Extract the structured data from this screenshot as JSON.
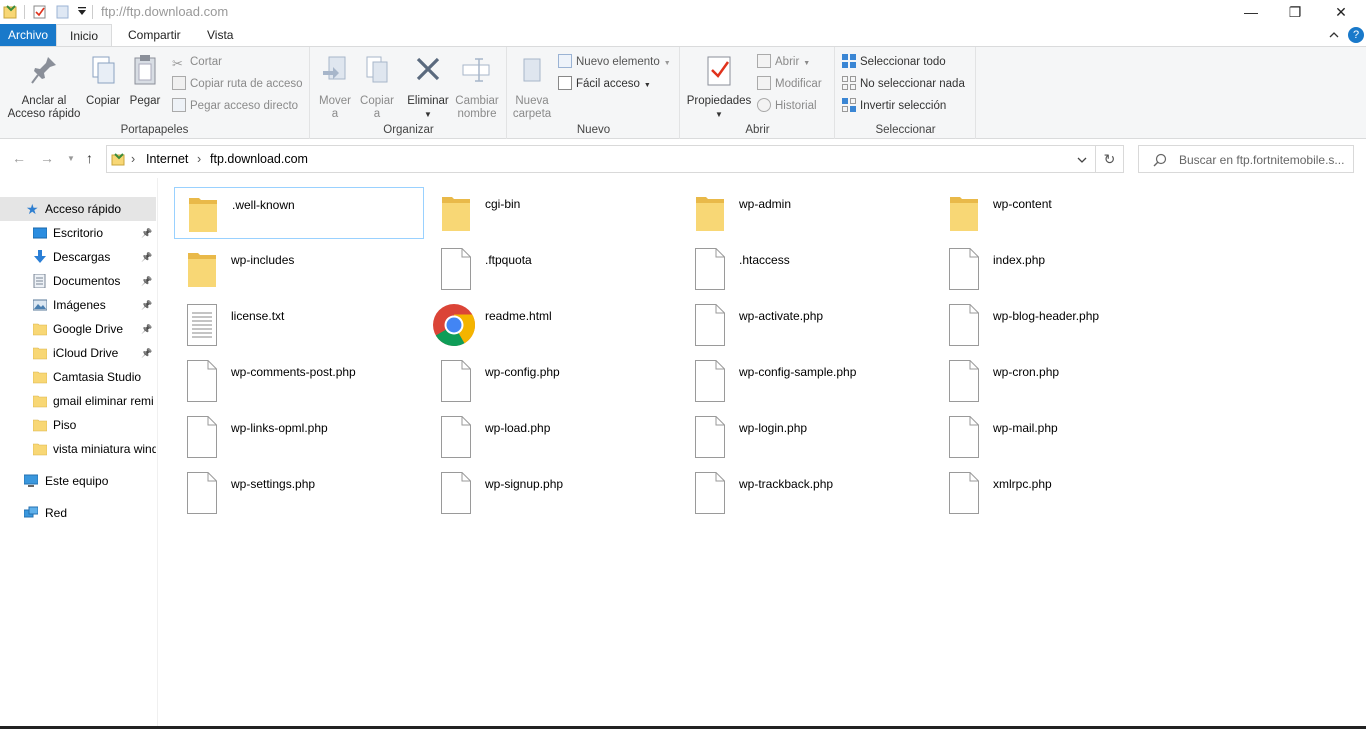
{
  "window": {
    "title": "ftp://ftp.download.com",
    "minimize": "—",
    "maximize": "❐",
    "close": "✕"
  },
  "tabs": {
    "file": "Archivo",
    "home": "Inicio",
    "share": "Compartir",
    "view": "Vista",
    "help": "?"
  },
  "ribbon": {
    "clipboard": {
      "label": "Portapapeles",
      "pin": "Anclar al\nAcceso rápido",
      "pin_l1": "Anclar al",
      "pin_l2": "Acceso rápido",
      "copy": "Copiar",
      "paste": "Pegar",
      "cut": "Cortar",
      "copy_path": "Copiar ruta de acceso",
      "paste_shortcut": "Pegar acceso directo"
    },
    "organize": {
      "label": "Organizar",
      "move_l1": "Mover",
      "move_l2": "a",
      "copy_l1": "Copiar",
      "copy_l2": "a",
      "delete": "Eliminar",
      "rename_l1": "Cambiar",
      "rename_l2": "nombre"
    },
    "new": {
      "label": "Nuevo",
      "new_folder_l1": "Nueva",
      "new_folder_l2": "carpeta",
      "new_item": "Nuevo elemento",
      "easy_access": "Fácil acceso"
    },
    "open": {
      "label": "Abrir",
      "properties": "Propiedades",
      "open": "Abrir",
      "edit": "Modificar",
      "history": "Historial"
    },
    "select": {
      "label": "Seleccionar",
      "select_all": "Seleccionar todo",
      "select_none": "No seleccionar nada",
      "invert": "Invertir selección"
    }
  },
  "address": {
    "crumbs": [
      "Internet",
      "ftp.download.com"
    ],
    "separator": "›",
    "search_placeholder": "Buscar en ftp.fortnitemobile.s..."
  },
  "sidebar": {
    "quick_access": "Acceso rápido",
    "items": [
      {
        "label": "Escritorio",
        "icon": "desktop-icon"
      },
      {
        "label": "Descargas",
        "icon": "downloads-icon"
      },
      {
        "label": "Documentos",
        "icon": "documents-icon"
      },
      {
        "label": "Imágenes",
        "icon": "pictures-icon"
      },
      {
        "label": "Google Drive",
        "icon": "folder-icon"
      },
      {
        "label": "iCloud Drive",
        "icon": "folder-icon"
      },
      {
        "label": "Camtasia Studio",
        "icon": "folder-icon"
      },
      {
        "label": "gmail eliminar remi",
        "icon": "folder-icon"
      },
      {
        "label": "Piso",
        "icon": "folder-icon"
      },
      {
        "label": "vista miniatura wind",
        "icon": "folder-icon"
      }
    ],
    "this_pc": "Este equipo",
    "network": "Red"
  },
  "files": [
    {
      "name": ".well-known",
      "type": "folder"
    },
    {
      "name": "cgi-bin",
      "type": "folder"
    },
    {
      "name": "wp-admin",
      "type": "folder"
    },
    {
      "name": "wp-content",
      "type": "folder"
    },
    {
      "name": "wp-includes",
      "type": "folder"
    },
    {
      "name": ".ftpquota",
      "type": "file"
    },
    {
      "name": ".htaccess",
      "type": "file"
    },
    {
      "name": "index.php",
      "type": "file"
    },
    {
      "name": "license.txt",
      "type": "text"
    },
    {
      "name": "readme.html",
      "type": "chrome"
    },
    {
      "name": "wp-activate.php",
      "type": "file"
    },
    {
      "name": "wp-blog-header.php",
      "type": "file"
    },
    {
      "name": "wp-comments-post.php",
      "type": "file"
    },
    {
      "name": "wp-config.php",
      "type": "file"
    },
    {
      "name": "wp-config-sample.php",
      "type": "file"
    },
    {
      "name": "wp-cron.php",
      "type": "file"
    },
    {
      "name": "wp-links-opml.php",
      "type": "file"
    },
    {
      "name": "wp-load.php",
      "type": "file"
    },
    {
      "name": "wp-login.php",
      "type": "file"
    },
    {
      "name": "wp-mail.php",
      "type": "file"
    },
    {
      "name": "wp-settings.php",
      "type": "file"
    },
    {
      "name": "wp-signup.php",
      "type": "file"
    },
    {
      "name": "wp-trackback.php",
      "type": "file"
    },
    {
      "name": "xmlrpc.php",
      "type": "file"
    }
  ],
  "colors": {
    "accent": "#1979ca",
    "folder": "#f8d775",
    "selection": "#cce8ff"
  }
}
